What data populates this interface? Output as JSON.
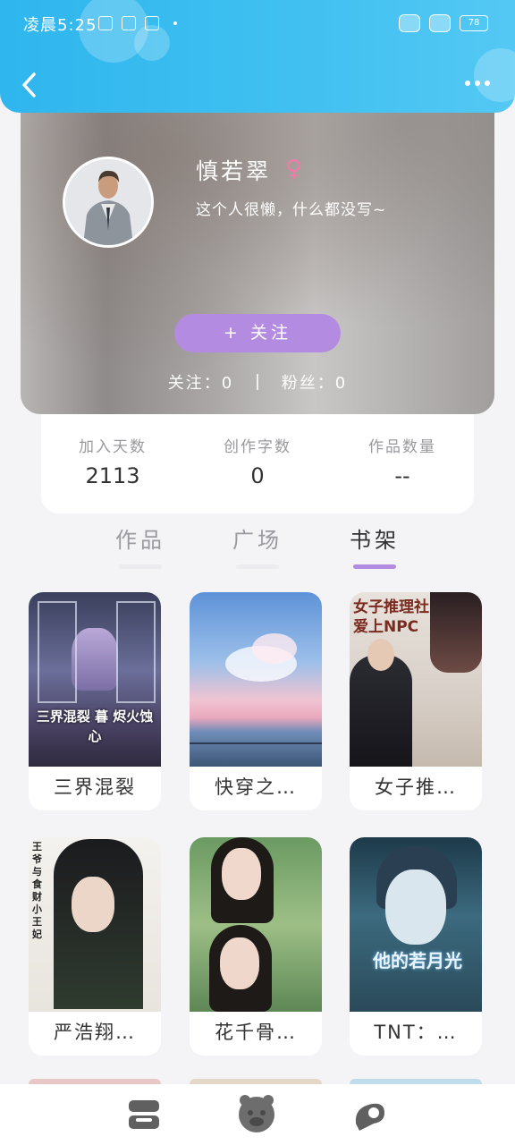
{
  "status_bar": {
    "time": "凌晨5:25",
    "battery": "78"
  },
  "profile": {
    "name": "慎若翠",
    "gender_icon": "female-icon",
    "bio": "这个人很懒，什么都没写~",
    "follow_label": "+ 关注",
    "following_label": "关注：",
    "following_count": "0",
    "fans_label": "粉丝：",
    "fans_count": "0"
  },
  "summary": [
    {
      "label": "加入天数",
      "value": "2113"
    },
    {
      "label": "创作字数",
      "value": "0"
    },
    {
      "label": "作品数量",
      "value": "--"
    }
  ],
  "tabs": [
    {
      "label": "作品",
      "active": false
    },
    {
      "label": "广场",
      "active": false
    },
    {
      "label": "书架",
      "active": true
    }
  ],
  "books": [
    {
      "title": "三界混裂",
      "cover_text": "三界混裂 暮 烬火蚀心"
    },
    {
      "title": "快穿之…",
      "cover_text": ""
    },
    {
      "title": "女子推…",
      "cover_text": "女子推理社 爱上NPC"
    },
    {
      "title": "严浩翔…",
      "cover_text": "王爷与食财小王妃"
    },
    {
      "title": "花千骨…",
      "cover_text": ""
    },
    {
      "title": "TNT：…",
      "cover_text": "他的若月光"
    }
  ],
  "colors": {
    "accent": "#b38be0",
    "header": "#3fc0f0",
    "gender": "#f07ba6"
  },
  "nav_icons": [
    "bookshelf-icon",
    "home-mascot-icon",
    "discover-icon"
  ]
}
